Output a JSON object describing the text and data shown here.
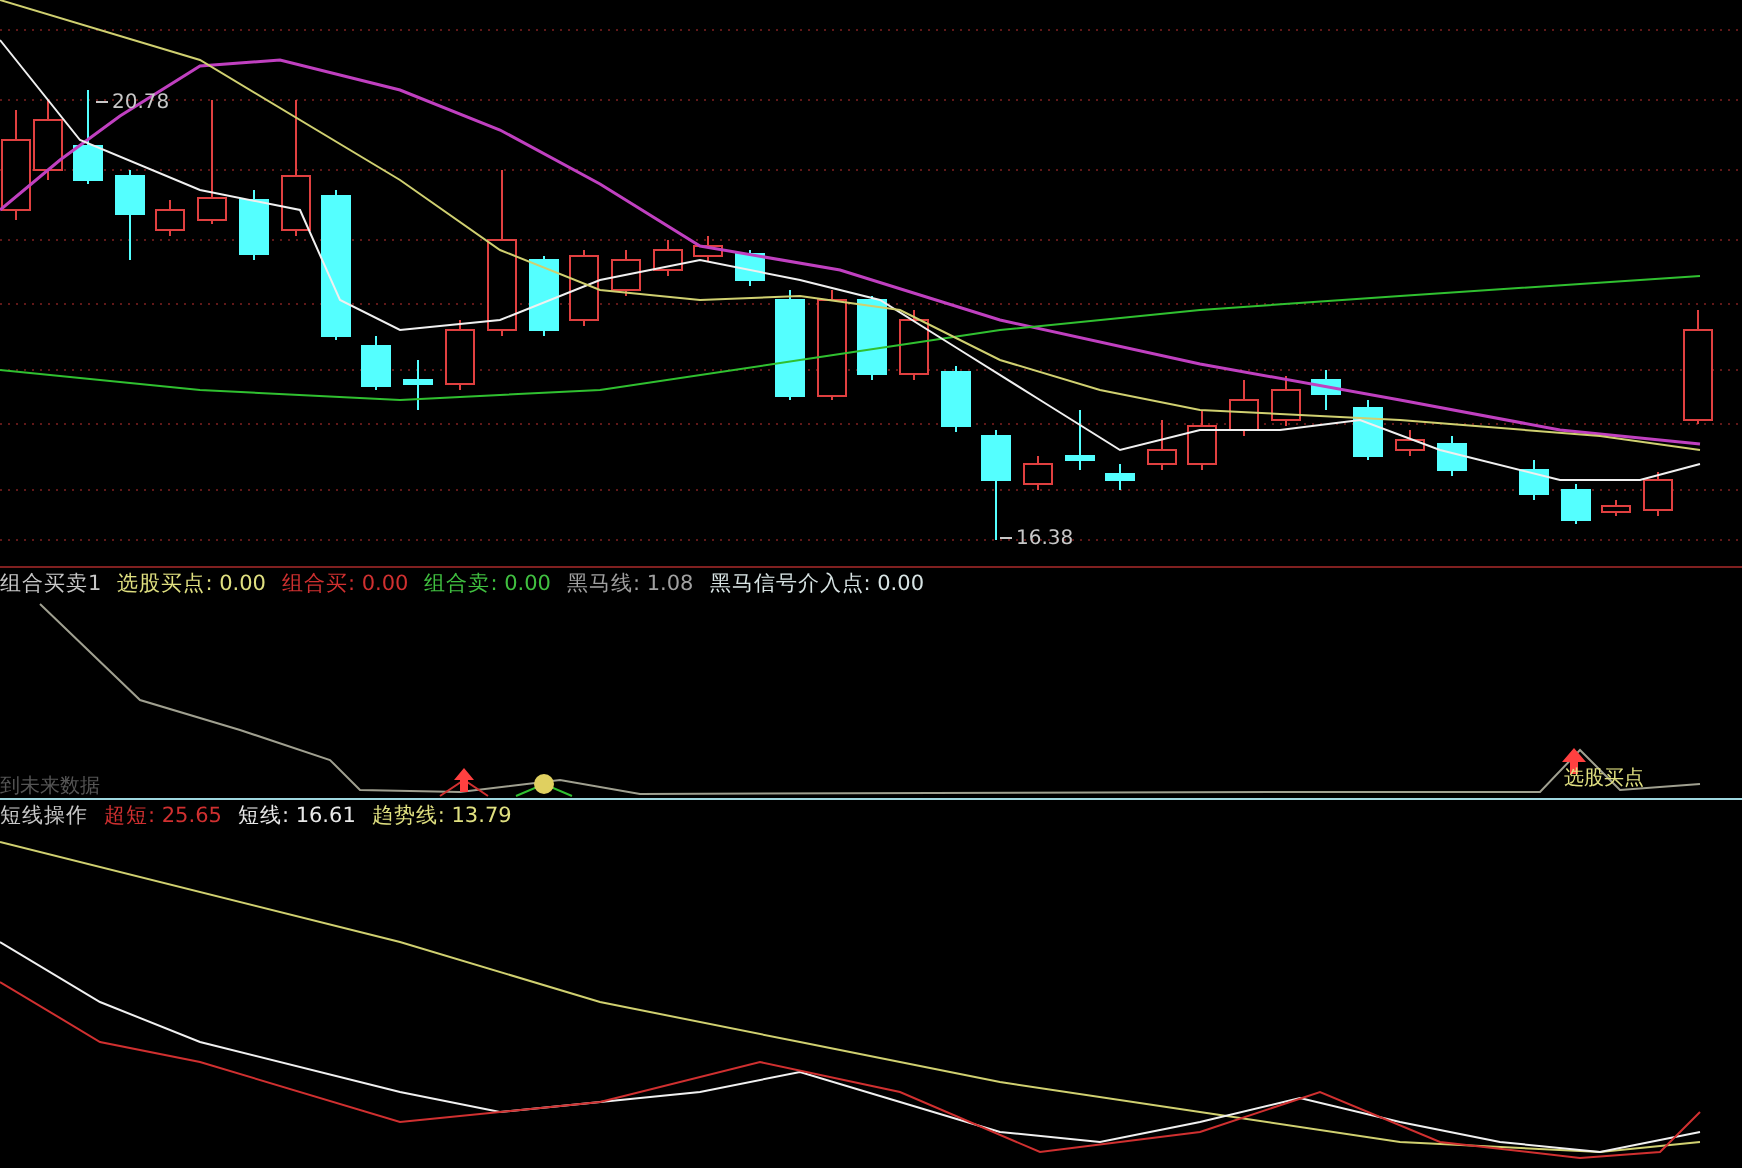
{
  "price_panel": {
    "price_labels": [
      {
        "text": "20.78",
        "kind": "high"
      },
      {
        "text": "16.38",
        "kind": "low"
      }
    ]
  },
  "signal_panel": {
    "title": "组合买卖1",
    "readouts": [
      {
        "text": "选股买点: 0.00",
        "color": "#e0e080"
      },
      {
        "text": "组合买: 0.00",
        "color": "#d03030"
      },
      {
        "text": "组合卖: 0.00",
        "color": "#40c040"
      },
      {
        "text": "黑马线: 1.08",
        "color": "#a0a0a0"
      },
      {
        "text": "黑马信号介入点: 0.00",
        "color": "#d8e4e4"
      }
    ],
    "faded_note": "到未来数据",
    "signal_label": "选股买点"
  },
  "trend_panel": {
    "title": "短线操作",
    "readouts": [
      {
        "text": "超短: 25.65",
        "color": "#d03030"
      },
      {
        "text": "短线: 16.61",
        "color": "#e8e8e8"
      },
      {
        "text": "趋势线: 13.79",
        "color": "#e0e080"
      }
    ]
  }
}
